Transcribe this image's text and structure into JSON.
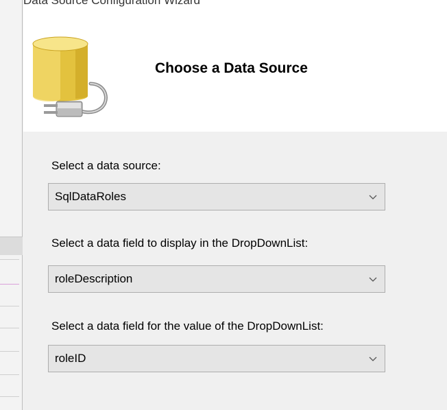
{
  "window": {
    "title": "Data Source Configuration Wizard"
  },
  "header": {
    "title": "Choose a Data Source",
    "icon": "database-plug-icon"
  },
  "form": {
    "fields": [
      {
        "label": "Select a data source:",
        "value": "SqlDataRoles"
      },
      {
        "label": "Select a data field to display in the DropDownList:",
        "value": "roleDescription"
      },
      {
        "label": "Select a data field for the value of the DropDownList:",
        "value": "roleID"
      }
    ],
    "dropdown_icon": "chevron-down-icon"
  },
  "colors": {
    "dialog_background": "#f0f0f0",
    "header_background": "#ffffff",
    "combo_background": "#e5e5e5",
    "combo_border": "#adadad",
    "icon_gold": "#e8c948"
  }
}
